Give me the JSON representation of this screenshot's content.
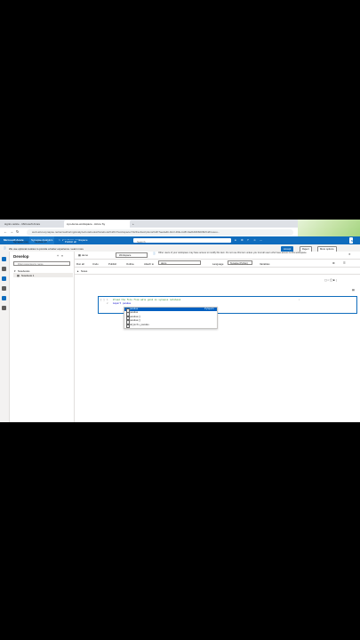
{
  "browser": {
    "tabs": [
      {
        "label": "signin-notice - Microsoft Azure"
      },
      {
        "label": "syn-demo-workspace - Azure Sy"
      },
      {
        "label": "+"
      }
    ],
    "url": "web.azuresynapse.net/en/authoring/analyze/notebooks/Notebook%201?workspace=%2Fsubscriptions%2F7aeda4b-9ccf-49fe-bc8f-9a2b4966006b%2Fresou..."
  },
  "azure_header": {
    "brand": "Microsoft Azure",
    "breadcrumb_service": "Synapse Analytics",
    "breadcrumb_sep": ">",
    "breadcrumb_workspace": "syn-demo-workspace",
    "search_placeholder": "Search",
    "user": "SYNAPSEDEMO"
  },
  "notice": {
    "text": "We use optional cookies to provide a better experience. Learn more",
    "accept": "Accept",
    "reject": "Reject",
    "more": "More options"
  },
  "develop": {
    "title": "Develop",
    "filter_placeholder": "Filter resources by name",
    "section": "Notebooks",
    "item": "Notebook 1",
    "tabs": [
      "Synapse Live",
      "Validate all",
      "Publish all"
    ]
  },
  "notebook": {
    "tab": "demo",
    "run_all": "Run all",
    "undo": "Undo",
    "publish": "Publish",
    "outline": "Outline",
    "attach_label": "Attach to",
    "attach_value": "demo",
    "language_label": "Language",
    "language_value": "Synapse (Python)",
    "variables": "Variables",
    "workspace_select": "Workspace",
    "info": "Other users of your workspace may have access to modify this item. Do not use this item unless you trust all users who have access to this workspace.",
    "cell_prefix": "1",
    "readme": "Notes",
    "code_lines": [
      {
        "num": "1",
        "text": "#read the file from adls gen2 in synapse notebook"
      },
      {
        "num": "2",
        "text": "import pandas"
      }
    ],
    "lang_badge": "PySpark",
    "autocomplete": [
      "pandas",
      "pandas",
      "pandas()",
      "pandas()",
      "objects_pandas"
    ]
  }
}
